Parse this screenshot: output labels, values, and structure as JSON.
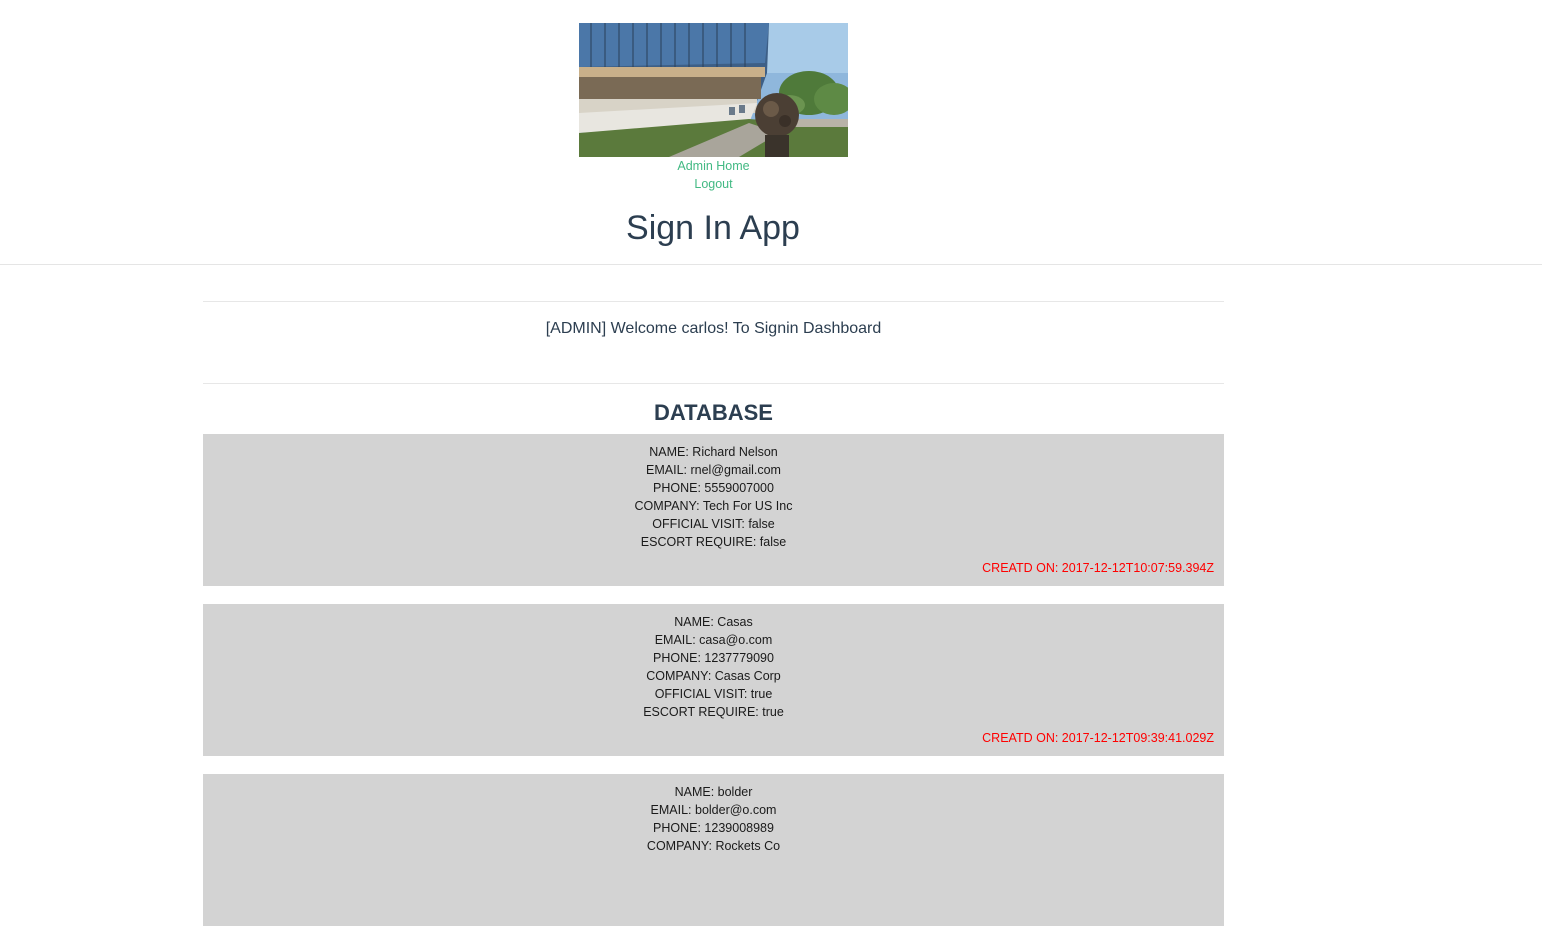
{
  "header": {
    "hero_image": "building-courtyard-sculpture-photo",
    "nav": [
      {
        "label": "Admin Home"
      },
      {
        "label": "Logout"
      }
    ],
    "title": "Sign In App"
  },
  "welcome_text": "[ADMIN] Welcome carlos! To Signin Dashboard",
  "database": {
    "heading": "DATABASE",
    "records": [
      {
        "name": "NAME: Richard Nelson",
        "email": "EMAIL: rnel@gmail.com",
        "phone": "PHONE: 5559007000",
        "company": "COMPANY: Tech For US Inc",
        "official_visit": "OFFICIAL VISIT: false",
        "escort_require": "ESCORT REQUIRE: false",
        "created_on": "CREATD ON: 2017-12-12T10:07:59.394Z"
      },
      {
        "name": "NAME: Casas",
        "email": "EMAIL: casa@o.com",
        "phone": "PHONE: 1237779090",
        "company": "COMPANY: Casas Corp",
        "official_visit": "OFFICIAL VISIT: true",
        "escort_require": "ESCORT REQUIRE: true",
        "created_on": "CREATD ON: 2017-12-12T09:39:41.029Z"
      },
      {
        "name": "NAME: bolder",
        "email": "EMAIL: bolder@o.com",
        "phone": "PHONE: 1239008989",
        "company": "COMPANY: Rockets Co"
      }
    ]
  },
  "colors": {
    "link": "#42b983",
    "heading": "#2c3e50",
    "record_bg": "#d3d3d3",
    "created_on": "#ff0000"
  }
}
